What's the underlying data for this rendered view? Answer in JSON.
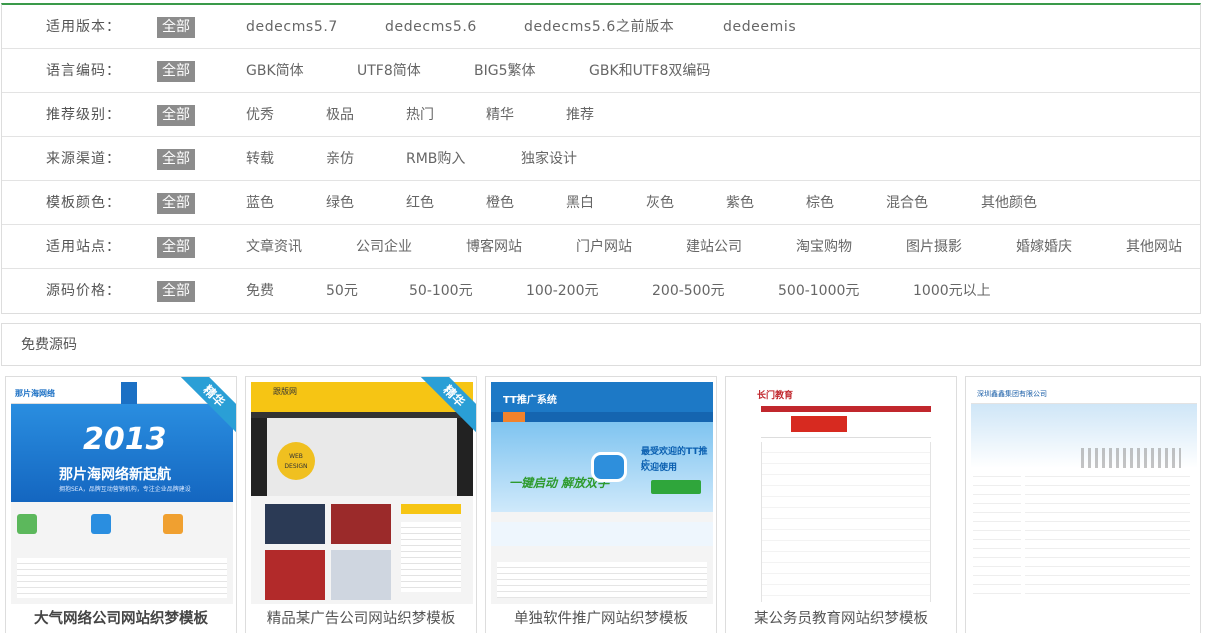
{
  "filters": [
    {
      "label": "适用版本：",
      "all": "全部",
      "options": [
        "dedecms5.7",
        "dedecms5.6",
        "dedecms5.6之前版本",
        "dedeemis"
      ]
    },
    {
      "label": "语言编码：",
      "all": "全部",
      "options": [
        "GBK简体",
        "UTF8简体",
        "BIG5繁体",
        "GBK和UTF8双编码"
      ]
    },
    {
      "label": "推荐级别：",
      "all": "全部",
      "options": [
        "优秀",
        "极品",
        "热门",
        "精华",
        "推荐"
      ]
    },
    {
      "label": "来源渠道：",
      "all": "全部",
      "options": [
        "转载",
        "亲仿",
        "RMB购入",
        "独家设计"
      ]
    },
    {
      "label": "模板颜色：",
      "all": "全部",
      "options": [
        "蓝色",
        "绿色",
        "红色",
        "橙色",
        "黑白",
        "灰色",
        "紫色",
        "棕色",
        "混合色",
        "其他颜色"
      ]
    },
    {
      "label": "适用站点：",
      "all": "全部",
      "options": [
        "文章资讯",
        "公司企业",
        "博客网站",
        "门户网站",
        "建站公司",
        "淘宝购物",
        "图片摄影",
        "婚嫁婚庆",
        "其他网站"
      ]
    },
    {
      "label": "源码价格：",
      "all": "全部",
      "options": [
        "免费",
        "50元",
        "50-100元",
        "100-200元",
        "200-500元",
        "500-1000元",
        "1000元以上"
      ]
    }
  ],
  "section": {
    "title": "免费源码"
  },
  "cards": [
    {
      "title": "大气网络公司网站织梦模板",
      "badge": "精华",
      "thumb_logo": "那片海网络",
      "thumb_headline": "2013",
      "thumb_sub": "那片海网络新起航",
      "thumb_sub2": "拥抱SEA，品牌互动营销机构，专注企业品牌建设"
    },
    {
      "title": "精品某广告公司网站织梦模板",
      "badge": "精华",
      "thumb_logo": "跟版网",
      "thumb_design": "WEB DESIGN"
    },
    {
      "title": "单独软件推广网站织梦模板",
      "thumb_logo": "TT推广系统",
      "thumb_t1": "最受欢迎的TT推广",
      "thumb_t2": "欢迎使用",
      "thumb_green": "一键启动 解放双手"
    },
    {
      "title": "某公务员教育网站织梦模板",
      "thumb_logo": "长门教育"
    },
    {
      "title": "",
      "thumb_logo": "深圳鑫鑫集团有限公司"
    }
  ],
  "colors": {
    "accent_green": "#3a9a4a",
    "badge_blue": "#2a9fd6",
    "all_tag": "#8c8c8c"
  }
}
